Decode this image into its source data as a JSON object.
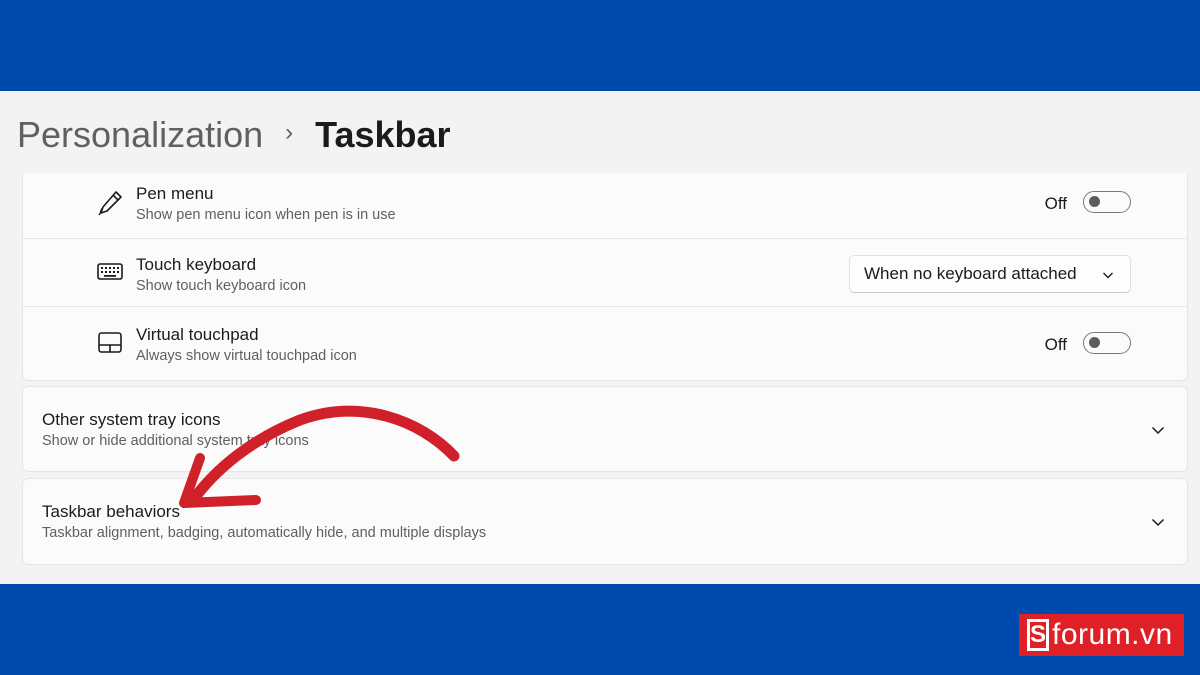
{
  "breadcrumb": {
    "parent": "Personalization",
    "separator": "›",
    "current": "Taskbar"
  },
  "taskbar_corner_icons": [
    {
      "title": "Pen menu",
      "subtitle": "Show pen menu icon when pen is in use",
      "icon": "pen-icon",
      "control": "toggle",
      "state_label": "Off",
      "on": false
    },
    {
      "title": "Touch keyboard",
      "subtitle": "Show touch keyboard icon",
      "icon": "keyboard-icon",
      "control": "dropdown",
      "selected": "When no keyboard attached"
    },
    {
      "title": "Virtual touchpad",
      "subtitle": "Always show virtual touchpad icon",
      "icon": "touchpad-icon",
      "control": "toggle",
      "state_label": "Off",
      "on": false
    }
  ],
  "sections": [
    {
      "title": "Other system tray icons",
      "subtitle": "Show or hide additional system tray icons",
      "icon": "chevron-down-icon"
    },
    {
      "title": "Taskbar behaviors",
      "subtitle": "Taskbar alignment, badging, automatically hide, and multiple displays",
      "icon": "chevron-down-icon"
    }
  ],
  "watermark": {
    "text": "forum.vn",
    "logo_letter": "S"
  },
  "colors": {
    "brand_blue": "#0049ad",
    "annotation_red": "#d0212b",
    "logo_red": "#e02027"
  }
}
